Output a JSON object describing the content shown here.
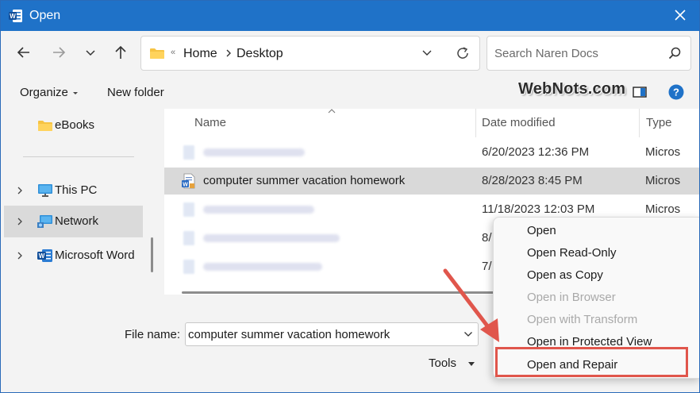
{
  "window": {
    "title": "Open"
  },
  "address": {
    "crumbs": [
      "Home",
      "Desktop"
    ],
    "overflow": "«"
  },
  "search": {
    "placeholder": "Search Naren Docs"
  },
  "command_bar": {
    "organize": "Organize",
    "new_folder": "New folder",
    "watermark": "WebNots.com"
  },
  "nav_pane": {
    "items": [
      {
        "label": "eBooks"
      },
      {
        "label": "This PC"
      },
      {
        "label": "Network"
      },
      {
        "label": "Microsoft Word"
      }
    ]
  },
  "file_list": {
    "columns": {
      "name": "Name",
      "date": "Date modified",
      "type": "Type"
    },
    "rows": [
      {
        "name": "",
        "date": "6/20/2023 12:36 PM",
        "type": "Micros"
      },
      {
        "name": "computer summer vacation homework",
        "date": "8/28/2023 8:45 PM",
        "type": "Micros"
      },
      {
        "name": "",
        "date": "11/18/2023 12:03 PM",
        "type": "Micros"
      },
      {
        "name": "",
        "date": "8/",
        "type": ""
      },
      {
        "name": "",
        "date": "7/",
        "type": ""
      }
    ]
  },
  "bottom": {
    "file_name_label": "File name:",
    "file_name_value": "computer summer vacation homework",
    "tools": "Tools"
  },
  "context_menu": {
    "items": [
      {
        "label": "Open",
        "enabled": true
      },
      {
        "label": "Open Read-Only",
        "enabled": true
      },
      {
        "label": "Open as Copy",
        "enabled": true
      },
      {
        "label": "Open in Browser",
        "enabled": false
      },
      {
        "label": "Open with Transform",
        "enabled": false
      },
      {
        "label": "Open in Protected View",
        "enabled": true
      },
      {
        "label": "Open and Repair",
        "enabled": true
      }
    ]
  },
  "colors": {
    "titlebar": "#1f72c8",
    "annotation": "#e0564c",
    "selection": "#d9d9d9"
  }
}
